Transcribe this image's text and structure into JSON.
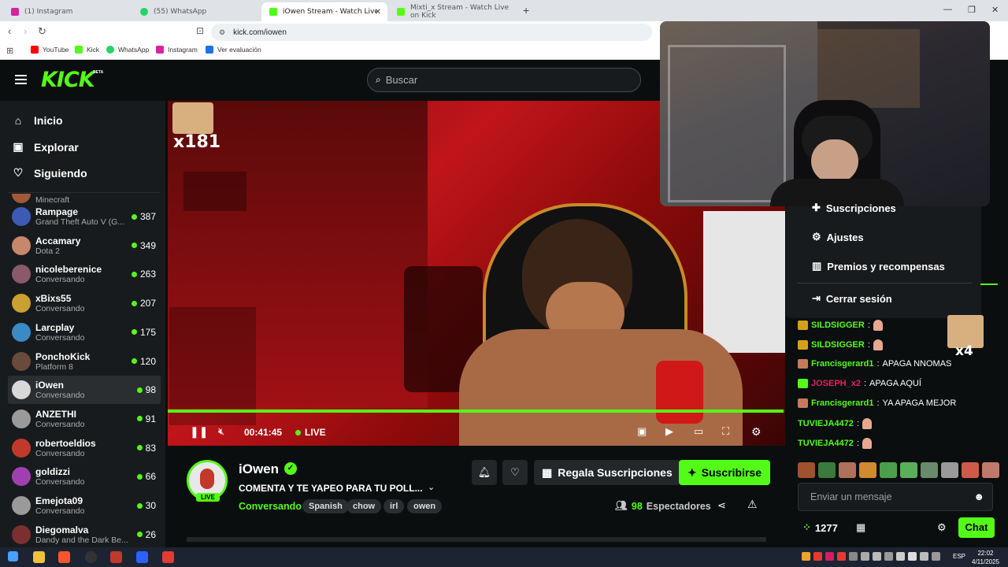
{
  "browser": {
    "tabs": [
      {
        "label": "(1) Instagram",
        "color": "#d6249f"
      },
      {
        "label": "(55) WhatsApp",
        "color": "#25d366"
      },
      {
        "label": "iOwen Stream - Watch Live on Ki",
        "color": "#53fc18"
      },
      {
        "label": "Mixti_x Stream - Watch Live on Kick",
        "color": "#53fc18"
      }
    ],
    "url": "kick.com/iowen",
    "bookmarks": [
      {
        "label": "YouTube",
        "color": "#ff0000"
      },
      {
        "label": "Kick",
        "color": "#53fc18"
      },
      {
        "label": "WhatsApp",
        "color": "#25d366"
      },
      {
        "label": "Instagram",
        "color": "#d6249f"
      },
      {
        "label": "Ver evaluación",
        "color": "#1a73e8"
      }
    ]
  },
  "header": {
    "logo": "KICK",
    "beta": "BETA",
    "search_placeholder": "Buscar"
  },
  "sidebar": {
    "nav": [
      {
        "label": "Inicio",
        "icon": "home-icon"
      },
      {
        "label": "Explorar",
        "icon": "compass-icon"
      },
      {
        "label": "Siguiendo",
        "icon": "heart-icon"
      }
    ],
    "partial_category": "Minecraft",
    "channels": [
      {
        "name": "Rampage",
        "category": "Grand Theft Auto V (G...",
        "viewers": "387",
        "color": "#3b5bb5"
      },
      {
        "name": "Accamary",
        "category": "Dota 2",
        "viewers": "349",
        "color": "#c7876a"
      },
      {
        "name": "nicoleberenice",
        "category": "Conversando",
        "viewers": "263",
        "color": "#8a5a6a"
      },
      {
        "name": "xBixs55",
        "category": "Conversando",
        "viewers": "207",
        "color": "#caa030"
      },
      {
        "name": "Larcplay",
        "category": "Conversando",
        "viewers": "175",
        "color": "#3a8ac5"
      },
      {
        "name": "PonchoKick",
        "category": "Platform 8",
        "viewers": "120",
        "color": "#6a4a3a"
      },
      {
        "name": "iOwen",
        "category": "Conversando",
        "viewers": "98",
        "color": "#d8d8d8"
      },
      {
        "name": "ANZETHI",
        "category": "Conversando",
        "viewers": "91",
        "color": "#9a9a9a"
      },
      {
        "name": "robertoeldios",
        "category": "Conversando",
        "viewers": "83",
        "color": "#c0392b"
      },
      {
        "name": "goldizzi",
        "category": "Conversando",
        "viewers": "66",
        "color": "#a040b0"
      },
      {
        "name": "Emejota09",
        "category": "Conversando",
        "viewers": "30",
        "color": "#9a9a9a"
      },
      {
        "name": "Diegomalva",
        "category": "Dandy and the Dark Be...",
        "viewers": "26",
        "color": "#7a3030"
      }
    ],
    "active_channel": "iOwen"
  },
  "player": {
    "timecode": "00:41:45",
    "live_label": "LIVE",
    "overlay_counter": "x181",
    "progress_fraction": 0.997
  },
  "stream": {
    "name": "iOwen",
    "live_badge": "LIVE",
    "title": "COMENTA Y TE YAPEO PARA TU POLL...",
    "category": "Conversando",
    "tags": [
      "Spanish",
      "chow",
      "irl",
      "owen"
    ],
    "gift_label": "Regala Suscripciones",
    "subscribe_label": "Suscribirse",
    "viewers_count": "98",
    "viewers_label": "Espectadores"
  },
  "menu": {
    "items": [
      {
        "label": "Suscripciones",
        "icon": "plus-icon"
      },
      {
        "label": "Ajustes",
        "icon": "gear-icon"
      },
      {
        "label": "Premios y recompensas",
        "icon": "podium-icon"
      },
      {
        "label": "Cerrar sesión",
        "icon": "logout-icon"
      }
    ]
  },
  "chat": {
    "emote_counter": "x4",
    "messages": [
      {
        "user": "SILDSIGGER",
        "text": "",
        "color": "#53fc18",
        "badge": "#d4a017"
      },
      {
        "user": "SILDSIGGER",
        "text": "",
        "color": "#53fc18",
        "badge": "#d4a017"
      },
      {
        "user": "Francisgerard1",
        "text": "APAGA NNOMAS",
        "color": "#53fc18",
        "badge": "#c77a5a"
      },
      {
        "user": "JOSEPH_x2",
        "text": "APAGA AQUÍ",
        "color": "#e0245e",
        "badge": "#53fc18"
      },
      {
        "user": "Francisgerard1",
        "text": "YA APAGA MEJOR",
        "color": "#53fc18",
        "badge": "#c77a5a"
      },
      {
        "user": "TUVIEJA4472",
        "text": "",
        "color": "#53fc18",
        "badge": ""
      },
      {
        "user": "TUVIEJA4472",
        "text": "",
        "color": "#53fc18",
        "badge": ""
      }
    ],
    "input_placeholder": "Enviar un mensaje",
    "points": "1277",
    "send_label": "Chat"
  },
  "taskbar": {
    "lang": "ESP",
    "time": "22:02",
    "date": "4/11/2025"
  }
}
